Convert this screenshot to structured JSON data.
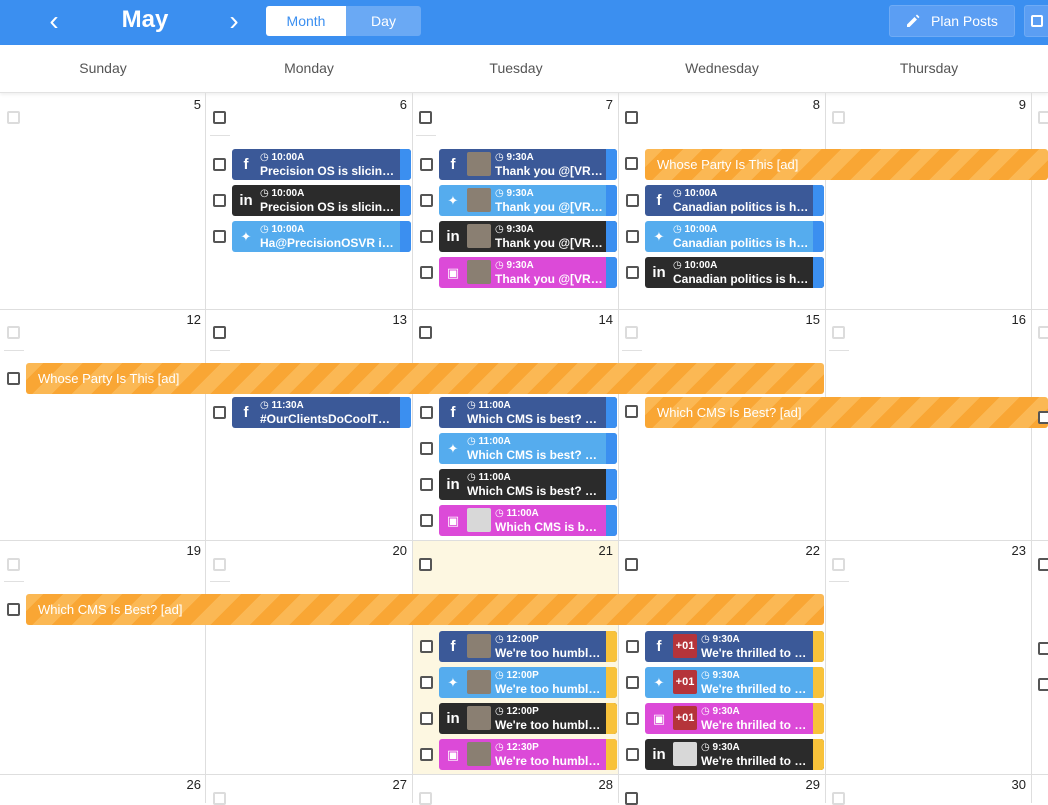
{
  "header": {
    "prev_label": "‹",
    "next_label": "›",
    "month": "May",
    "views": {
      "month": "Month",
      "day": "Day"
    },
    "plan_posts": "Plan Posts",
    "accent_color": "#3b8ff0"
  },
  "weekdays": [
    "Sunday",
    "Monday",
    "Tuesday",
    "Wednesday",
    "Thursday"
  ],
  "weeks": [
    {
      "days": [
        "5",
        "6",
        "7",
        "8",
        "9"
      ]
    },
    {
      "days": [
        "12",
        "13",
        "14",
        "15",
        "16"
      ]
    },
    {
      "days": [
        "19",
        "20",
        "21",
        "22",
        "23"
      ]
    },
    {
      "days": [
        "26",
        "27",
        "28",
        "29",
        "30"
      ]
    }
  ],
  "ads": {
    "whose_party": "Whose Party Is This [ad]",
    "which_cms": "Which CMS Is Best? [ad]"
  },
  "icons": {
    "facebook": "f",
    "twitter": "t",
    "linkedin": "in",
    "instagram": "ig"
  },
  "posts": {
    "w1_mon": [
      {
        "network": "facebook",
        "time": "10:00A",
        "text": "Precision OS is slicing ..."
      },
      {
        "network": "linkedin",
        "time": "10:00A",
        "text": "Precision OS is slicing ..."
      },
      {
        "network": "twitter",
        "time": "10:00A",
        "text": "Ha@PrecisionOSVR is ..."
      }
    ],
    "w1_tue": [
      {
        "network": "facebook",
        "time": "9:30A",
        "text": "Thank you @[VR/..."
      },
      {
        "network": "twitter",
        "time": "9:30A",
        "text": "Thank you @[VR/..."
      },
      {
        "network": "linkedin",
        "time": "9:30A",
        "text": "Thank you @[VR/..."
      },
      {
        "network": "instagram",
        "time": "9:30A",
        "text": "Thank you @[VR/..."
      }
    ],
    "w1_wed": [
      {
        "network": "facebook",
        "time": "10:00A",
        "text": "Canadian politics is he..."
      },
      {
        "network": "twitter",
        "time": "10:00A",
        "text": "Canadian politics is he..."
      },
      {
        "network": "linkedin",
        "time": "10:00A",
        "text": "Canadian politics is he..."
      }
    ],
    "w2_mon": [
      {
        "network": "facebook",
        "time": "11:30A",
        "text": "#OurClientsDoCoolThi..."
      }
    ],
    "w2_tue": [
      {
        "network": "facebook",
        "time": "11:00A",
        "text": "Which CMS is best? W..."
      },
      {
        "network": "twitter",
        "time": "11:00A",
        "text": "Which CMS is best? W..."
      },
      {
        "network": "linkedin",
        "time": "11:00A",
        "text": "Which CMS is best? W..."
      },
      {
        "network": "instagram",
        "time": "11:00A",
        "text": "Which CMS is bes..."
      }
    ],
    "w3_tue": [
      {
        "network": "facebook",
        "time": "12:00P",
        "text": "We're too humble ..."
      },
      {
        "network": "twitter",
        "time": "12:00P",
        "text": "We're too humble ..."
      },
      {
        "network": "linkedin",
        "time": "12:00P",
        "text": "We're too humble ..."
      },
      {
        "network": "instagram",
        "time": "12:30P",
        "text": "We're too humble ..."
      }
    ],
    "w3_wed": [
      {
        "network": "facebook",
        "time": "9:30A",
        "text": "We're thrilled to be...",
        "thumb_label": "+01"
      },
      {
        "network": "twitter",
        "time": "9:30A",
        "text": "We're thrilled to be...",
        "thumb_label": "+01"
      },
      {
        "network": "instagram",
        "time": "9:30A",
        "text": "We're thrilled to be...",
        "thumb_label": "+01"
      },
      {
        "network": "linkedin",
        "time": "9:30A",
        "text": "We're thrilled to be..."
      }
    ]
  },
  "colors": {
    "facebook": "#3b5998",
    "twitter": "#55acee",
    "linkedin": "#2b2b2b",
    "instagram": "#dc4ad8",
    "ad": "#f9a634",
    "today": "#fdf7e1"
  }
}
